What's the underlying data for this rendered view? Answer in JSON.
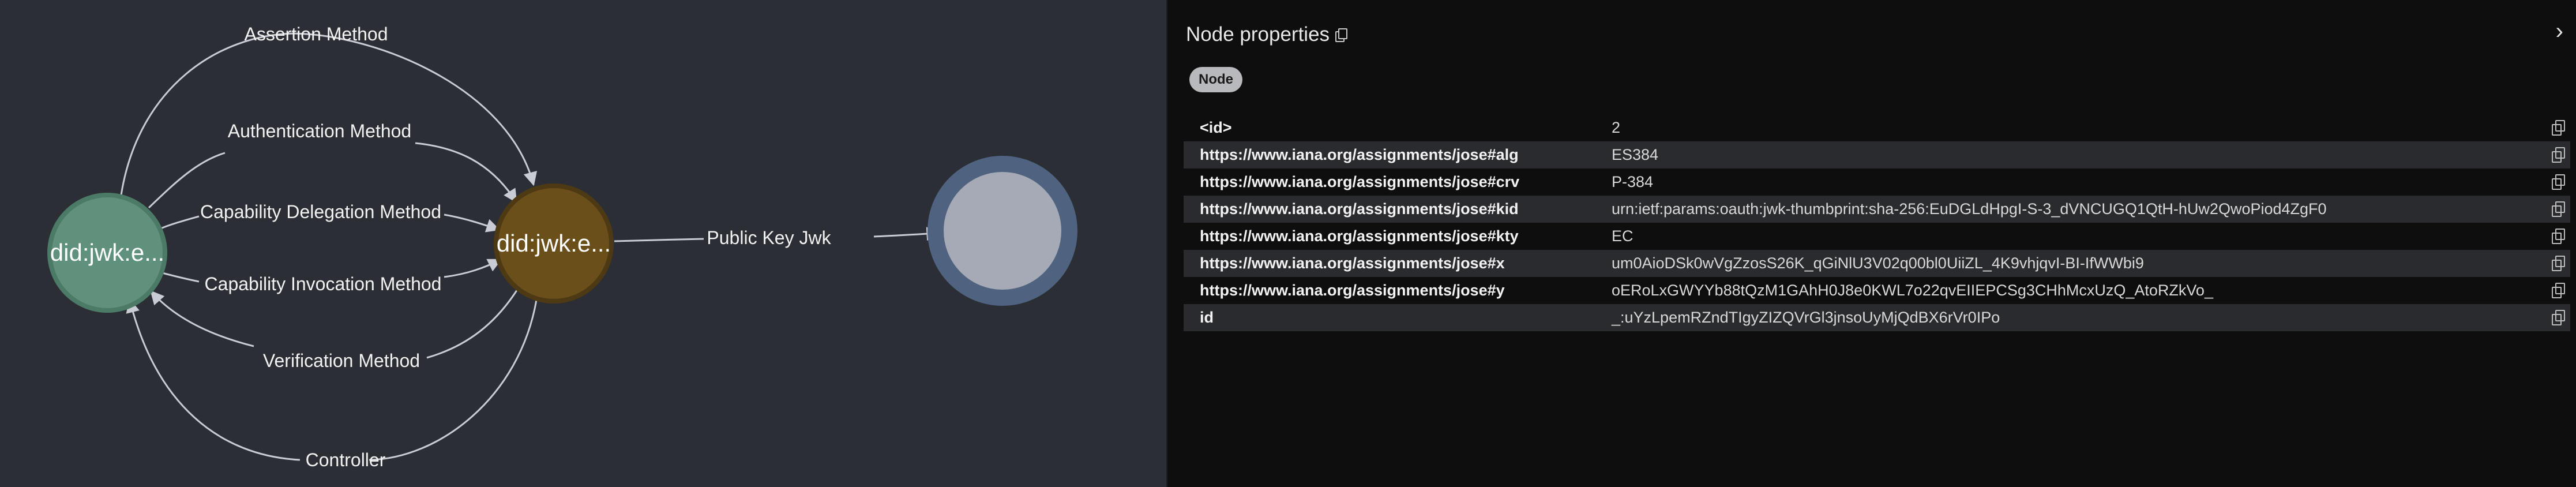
{
  "graph": {
    "nodes": [
      {
        "id": "subject",
        "label": "did:jwk:e...",
        "fill": "#5f917c",
        "stroke": "#4b7a66"
      },
      {
        "id": "key",
        "label": "did:jwk:e...",
        "fill": "#6b4f1a",
        "stroke": "#4d3a14"
      },
      {
        "id": "blank",
        "label": "",
        "fill": "#a6aab6",
        "stroke": "#4f6280"
      }
    ],
    "edges": [
      {
        "label": "Assertion Method"
      },
      {
        "label": "Authentication Method"
      },
      {
        "label": "Capability Delegation Method"
      },
      {
        "label": "Capability Invocation Method"
      },
      {
        "label": "Verification Method"
      },
      {
        "label": "Controller"
      },
      {
        "label": "Public Key Jwk"
      }
    ]
  },
  "panel": {
    "title": "Node properties",
    "badge": "Node",
    "properties": [
      {
        "key": "<id>",
        "value": "2"
      },
      {
        "key": "https://www.iana.org/assignments/jose#alg",
        "value": "ES384"
      },
      {
        "key": "https://www.iana.org/assignments/jose#crv",
        "value": "P-384"
      },
      {
        "key": "https://www.iana.org/assignments/jose#kid",
        "value": "urn:ietf:params:oauth:jwk-thumbprint:sha-256:EuDGLdHpgI-S-3_dVNCUGQ1QtH-hUw2QwoPiod4ZgF0"
      },
      {
        "key": "https://www.iana.org/assignments/jose#kty",
        "value": "EC"
      },
      {
        "key": "https://www.iana.org/assignments/jose#x",
        "value": "um0AioDSk0wVgZzosS26K_qGiNlU3V02q00bl0UiiZL_4K9vhjqvI-BI-IfWWbi9"
      },
      {
        "key": "https://www.iana.org/assignments/jose#y",
        "value": "oERoLxGWYYb88tQzM1GAhH0J8e0KWL7o22qvEIIEPCSg3CHhMcxUzQ_AtoRZkVo_"
      },
      {
        "key": "id",
        "value": "_:uYzLpemRZndTIgyZIZQVrGl3jnsoUyMjQdBX6rVr0IPo"
      }
    ]
  }
}
